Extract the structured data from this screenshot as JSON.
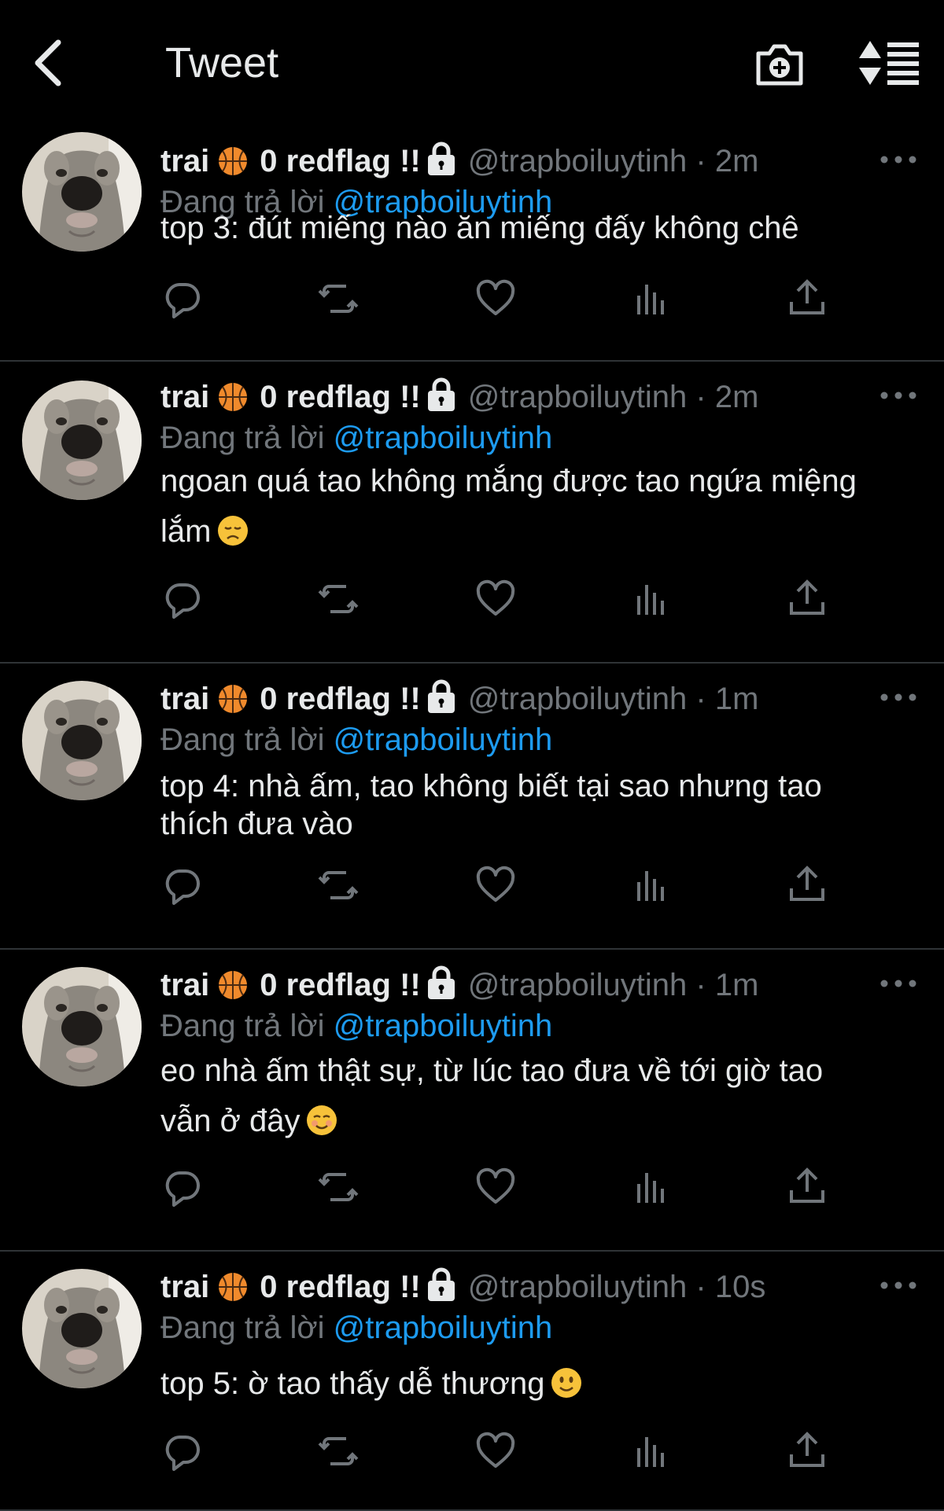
{
  "header": {
    "title": "Tweet"
  },
  "colors": {
    "background": "#000000",
    "text": "#e7e9ea",
    "muted": "#71767b",
    "link": "#1d9bf0",
    "divider": "#2f3336"
  },
  "tweets": [
    {
      "display_name": "trai",
      "name_suffix": "0 redflag !!",
      "handle": "@trapboiluytinh",
      "time": "2m",
      "reply_prefix": "Đang trả lời",
      "reply_to": "@trapboiluytinh",
      "lines": [
        "top 3: đút miếng nào ăn miếng đấy không chê"
      ],
      "emoji": ""
    },
    {
      "display_name": "trai",
      "name_suffix": "0 redflag !!",
      "handle": "@trapboiluytinh",
      "time": "2m",
      "reply_prefix": "Đang trả lời",
      "reply_to": "@trapboiluytinh",
      "lines": [
        "ngoan quá tao không mắng được tao ngứa miệng",
        "lắm"
      ],
      "emoji": "disappointed-face"
    },
    {
      "display_name": "trai",
      "name_suffix": "0 redflag !!",
      "handle": "@trapboiluytinh",
      "time": "1m",
      "reply_prefix": "Đang trả lời",
      "reply_to": "@trapboiluytinh",
      "lines": [
        "top 4: nhà ấm, tao không biết tại sao nhưng tao",
        "thích đưa vào"
      ],
      "emoji": ""
    },
    {
      "display_name": "trai",
      "name_suffix": "0 redflag !!",
      "handle": "@trapboiluytinh",
      "time": "1m",
      "reply_prefix": "Đang trả lời",
      "reply_to": "@trapboiluytinh",
      "lines": [
        "eo nhà ấm thật sự, từ lúc tao đưa về tới giờ tao",
        "vẫn ở đây"
      ],
      "emoji": "smiling-face"
    },
    {
      "display_name": "trai",
      "name_suffix": "0 redflag !!",
      "handle": "@trapboiluytinh",
      "time": "10s",
      "reply_prefix": "Đang trả lời",
      "reply_to": "@trapboiluytinh",
      "lines": [
        "top 5: ờ tao thấy dễ thương"
      ],
      "emoji": "slightly-smiling-face"
    }
  ],
  "icons": {
    "name_emoji": "basketball-icon",
    "name_lock": "lock-icon",
    "actions": [
      "reply-icon",
      "retweet-icon",
      "like-icon",
      "views-icon",
      "share-icon"
    ]
  }
}
